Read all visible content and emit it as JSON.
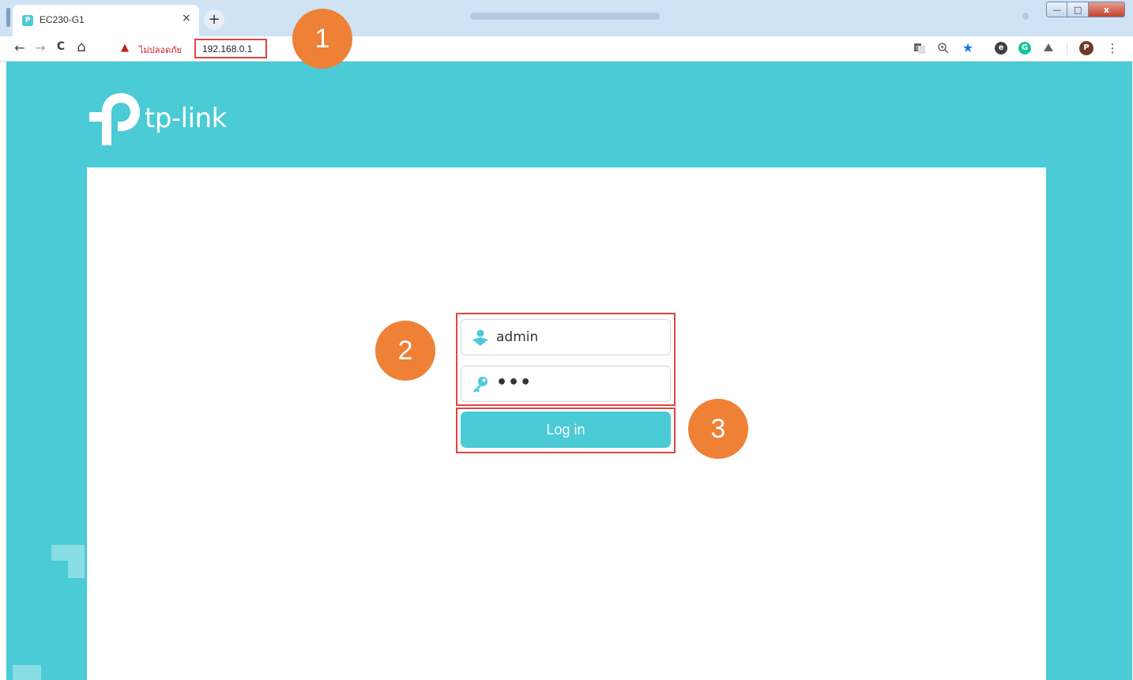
{
  "browser": {
    "tab": {
      "title": "EC230-G1",
      "close_glyph": "×",
      "favicon": "tp-link-favicon-icon"
    },
    "new_tab_glyph": "+",
    "window_buttons": {
      "minimize": "—",
      "maximize": "□",
      "close": "x"
    },
    "nav": {
      "back": "←",
      "forward": "→",
      "reload": "C",
      "home": "⌂"
    },
    "security": {
      "icon": "warning-triangle-icon",
      "label": "ไม่ปลอดภัย"
    },
    "url": "192.168.0.1",
    "toolbar_icons": [
      "translate-icon",
      "zoom-icon",
      "bookmark-star-icon",
      "extension-icon",
      "grammarly-icon",
      "drive-icon"
    ],
    "profile_initial": "P",
    "menu_glyph": "⋮"
  },
  "page": {
    "brand": "tp-link",
    "username_field": {
      "value": "admin",
      "icon": "user-icon"
    },
    "password_field": {
      "masked_value": "•••",
      "icon": "key-icon"
    },
    "login_button_label": "Log in"
  },
  "callouts": [
    "1",
    "2",
    "3"
  ],
  "colors": {
    "brand_teal": "#4acbd6",
    "callout_orange": "#ee8136",
    "highlight_red": "#e0453e",
    "insecure_red": "#c5221f"
  }
}
